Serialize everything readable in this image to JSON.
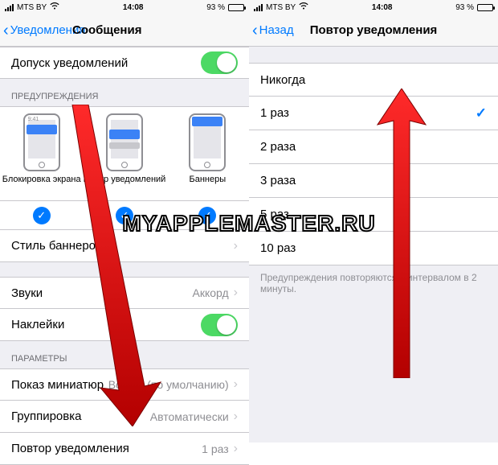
{
  "statusbar": {
    "carrier": "MTS BY",
    "time": "14:08",
    "battery": "93 %"
  },
  "left": {
    "back": "Уведомления",
    "title": "Сообщения",
    "allow": {
      "label": "Допуск уведомлений"
    },
    "alerts_header": "ПРЕДУПРЕЖДЕНИЯ",
    "alert_styles": {
      "lock": "Блокировка экрана",
      "center": "Центр уведомлений",
      "banner": "Баннеры",
      "lock_time": "9:41"
    },
    "banner_style": {
      "label": "Стиль баннеров"
    },
    "sounds": {
      "label": "Звуки",
      "value": "Аккорд"
    },
    "stickers": {
      "label": "Наклейки"
    },
    "options_header": "ПАРАМЕТРЫ",
    "previews": {
      "label": "Показ миниатюр",
      "value": "Всегда (по умолчанию)"
    },
    "grouping": {
      "label": "Группировка",
      "value": "Автоматически"
    },
    "repeat": {
      "label": "Повтор уведомления",
      "value": "1 раз"
    }
  },
  "right": {
    "back": "Назад",
    "title": "Повтор уведомления",
    "options": [
      "Никогда",
      "1 раз",
      "2 раза",
      "3 раза",
      "5 раз",
      "10 раз"
    ],
    "selected": "1 раз",
    "footer": "Предупреждения повторяются с интервалом в 2 минуты."
  },
  "watermark": "MYAPPLEMASTER.RU"
}
